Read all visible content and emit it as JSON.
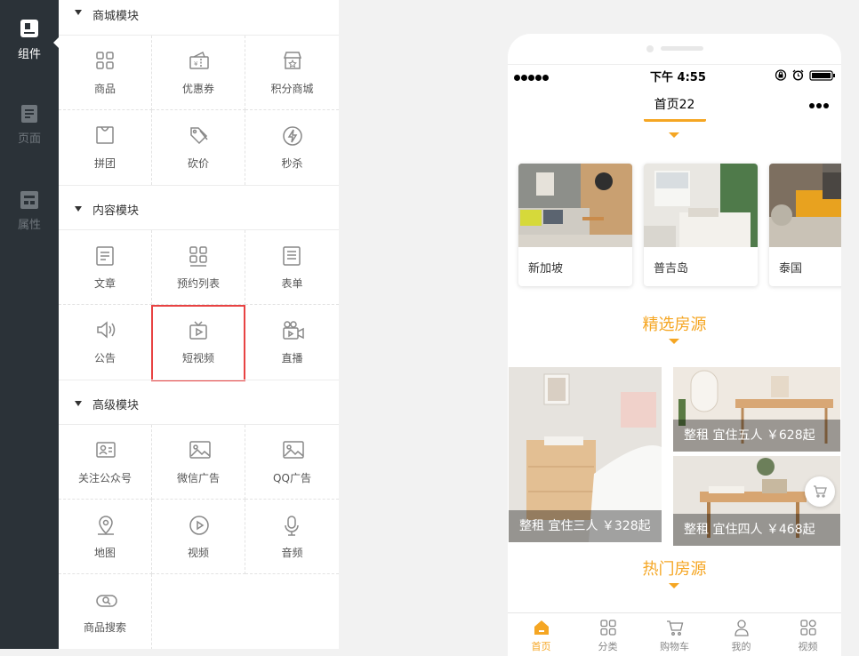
{
  "rail": {
    "items": [
      {
        "label": "组件",
        "icon": "component-icon",
        "active": true
      },
      {
        "label": "页面",
        "icon": "page-icon",
        "active": false
      },
      {
        "label": "属性",
        "icon": "property-icon",
        "active": false
      }
    ]
  },
  "sections": [
    {
      "title": "商城模块",
      "items": [
        {
          "label": "商品",
          "icon": "grid-icon"
        },
        {
          "label": "优惠券",
          "icon": "coupon-icon"
        },
        {
          "label": "积分商城",
          "icon": "store-icon"
        },
        {
          "label": "拼团",
          "icon": "bag-icon"
        },
        {
          "label": "砍价",
          "icon": "tag-icon"
        },
        {
          "label": "秒杀",
          "icon": "flash-icon"
        }
      ]
    },
    {
      "title": "内容模块",
      "items": [
        {
          "label": "文章",
          "icon": "article-icon"
        },
        {
          "label": "预约列表",
          "icon": "list-grid-icon"
        },
        {
          "label": "表单",
          "icon": "form-icon"
        },
        {
          "label": "公告",
          "icon": "speaker-icon"
        },
        {
          "label": "短视频",
          "icon": "tv-icon"
        },
        {
          "label": "直播",
          "icon": "live-camera-icon"
        }
      ]
    },
    {
      "title": "高级模块",
      "items": [
        {
          "label": "关注公众号",
          "icon": "follow-account-icon"
        },
        {
          "label": "微信广告",
          "icon": "image-icon"
        },
        {
          "label": "QQ广告",
          "icon": "image-icon"
        },
        {
          "label": "地图",
          "icon": "map-icon"
        },
        {
          "label": "视频",
          "icon": "play-icon"
        },
        {
          "label": "音频",
          "icon": "microphone-icon"
        },
        {
          "label": "商品搜索",
          "icon": "search-toggle-icon"
        }
      ]
    }
  ],
  "phone": {
    "status": {
      "time": "下午 4:55"
    },
    "title": "首页22",
    "destinations": [
      {
        "name": "新加坡"
      },
      {
        "name": "普吉岛"
      },
      {
        "name": "泰国"
      }
    ],
    "featured_heading": "精选房源",
    "listings": [
      {
        "caption": "整租 宜住三人 ￥328起"
      },
      {
        "caption": "整租 宜住五人 ￥628起"
      },
      {
        "caption": "整租 宜住四人 ￥468起"
      }
    ],
    "hot_heading": "热门房源",
    "tabs": [
      {
        "label": "首页",
        "icon": "home-icon",
        "active": true
      },
      {
        "label": "分类",
        "icon": "category-icon",
        "active": false
      },
      {
        "label": "购物车",
        "icon": "cart-icon",
        "active": false
      },
      {
        "label": "我的",
        "icon": "user-icon",
        "active": false
      },
      {
        "label": "视频",
        "icon": "video-icon",
        "active": false
      }
    ]
  },
  "colors": {
    "accent": "#f5a623",
    "highlight": "#e84343",
    "rail_bg": "#2b3238"
  }
}
